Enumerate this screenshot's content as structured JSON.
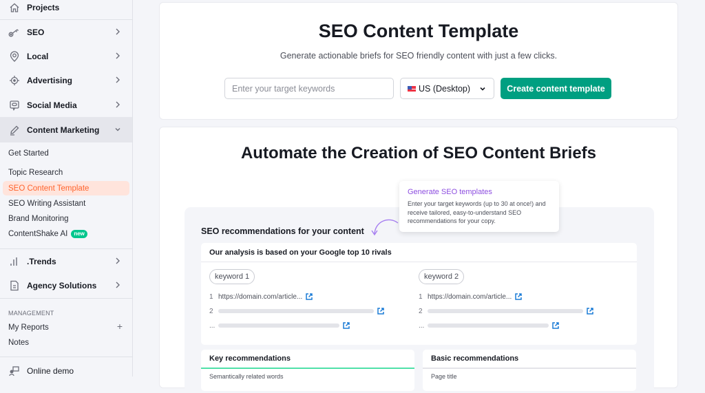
{
  "sidebar": {
    "projects": "Projects",
    "items": [
      {
        "label": "SEO",
        "icon": "key-icon"
      },
      {
        "label": "Local",
        "icon": "location-pin-icon"
      },
      {
        "label": "Advertising",
        "icon": "target-icon"
      },
      {
        "label": "Social Media",
        "icon": "chat-bubble-icon"
      },
      {
        "label": "Content Marketing",
        "icon": "pencil-icon"
      }
    ],
    "content_marketing_sub": [
      {
        "label": "Get Started"
      },
      {
        "label": "Topic Research"
      },
      {
        "label": "SEO Content Template"
      },
      {
        "label": "SEO Writing Assistant"
      },
      {
        "label": "Brand Monitoring"
      },
      {
        "label": "ContentShake AI",
        "badge": "new"
      }
    ],
    "trends": ".Trends",
    "agency": "Agency Solutions",
    "management_heading": "MANAGEMENT",
    "my_reports": "My Reports",
    "notes": "Notes",
    "online_demo": "Online demo"
  },
  "hero": {
    "title": "SEO Content Template",
    "subtitle": "Generate actionable briefs for SEO friendly content with just a few clicks.",
    "keyword_placeholder": "Enter your target keywords",
    "keyword_value": "",
    "database": "US (Desktop)",
    "create_button": "Create content template"
  },
  "promo": {
    "title": "Automate the Creation of SEO Content Briefs",
    "panel_title": "SEO recommendations for your content",
    "rivals_heading": "Our analysis is based on your Google top 10 rivals",
    "keywords": [
      {
        "chip": "keyword 1",
        "rows": [
          {
            "num": "1",
            "url": "https://domain.com/article..."
          },
          {
            "num": "2",
            "url": ""
          },
          {
            "num": "...",
            "url": ""
          }
        ]
      },
      {
        "chip": "keyword 2",
        "rows": [
          {
            "num": "1",
            "url": "https://domain.com/article..."
          },
          {
            "num": "2",
            "url": ""
          },
          {
            "num": "...",
            "url": ""
          }
        ]
      }
    ],
    "key_recommendations": "Key recommendations",
    "basic_recommendations": "Basic recommendations",
    "key_row_label": "Semantically related words",
    "basic_row_label": "Page title",
    "tooltip_title": "Generate SEO templates",
    "tooltip_body": "Enter your target keywords (up to 30 at once!) and receive tailored, easy-to-understand SEO recommendations for your copy."
  },
  "colors": {
    "accent_green": "#009f81",
    "active_orange": "#ff642d",
    "tooltip_purple": "#8d4ee0",
    "link_blue": "#1a7bd6"
  }
}
